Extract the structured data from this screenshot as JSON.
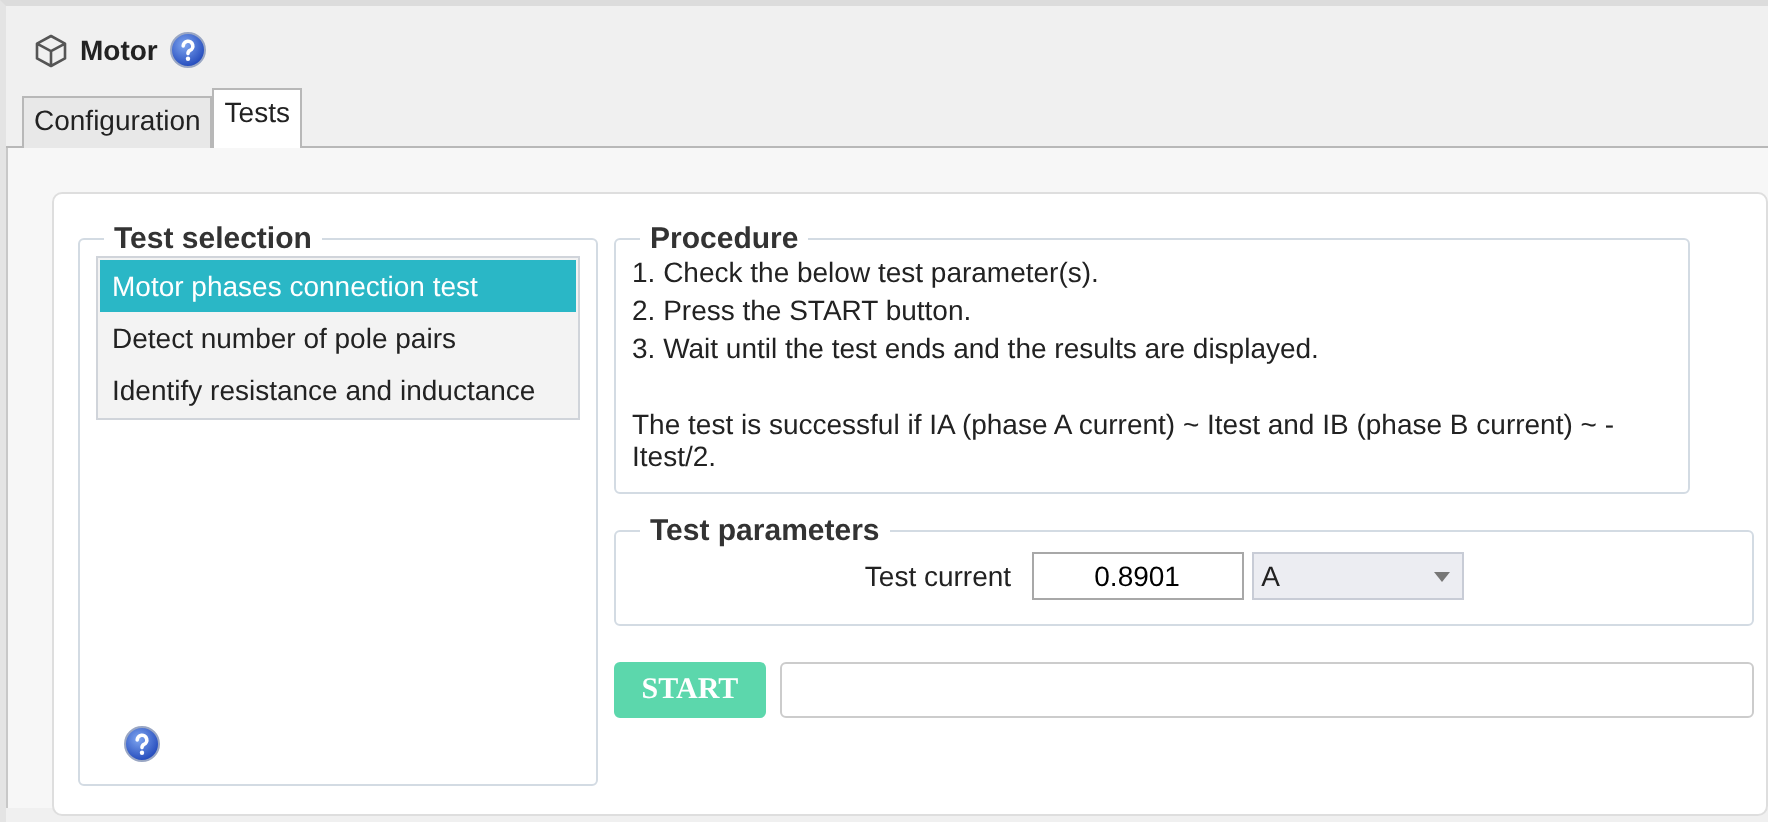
{
  "header": {
    "title": "Motor"
  },
  "tabs": [
    {
      "label": "Configuration",
      "selected": false
    },
    {
      "label": "Tests",
      "selected": true
    }
  ],
  "test_selection": {
    "title": "Test selection",
    "items": [
      {
        "label": "Motor phases connection test",
        "selected": true
      },
      {
        "label": "Detect number of pole pairs",
        "selected": false
      },
      {
        "label": "Identify resistance and inductance",
        "selected": false
      }
    ]
  },
  "procedure": {
    "title": "Procedure",
    "steps": [
      "1. Check the below test parameter(s).",
      "2. Press the START button.",
      "3. Wait until the test ends and the results are displayed."
    ],
    "note": "The test is successful if IA (phase A current) ~ Itest and IB (phase B current) ~ -Itest/2."
  },
  "test_parameters": {
    "title": "Test parameters",
    "label": "Test current",
    "value": "0.8901",
    "unit": "A"
  },
  "start_button": {
    "label": "START"
  }
}
